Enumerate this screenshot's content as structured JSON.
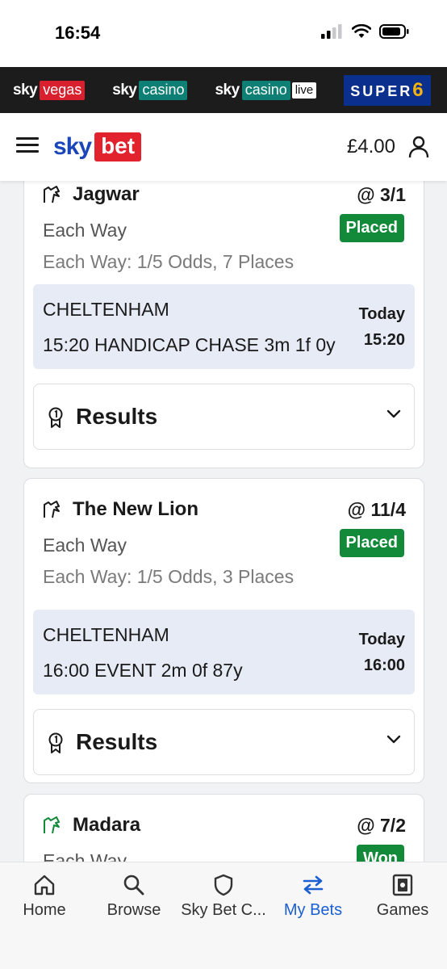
{
  "status_bar": {
    "time": "16:54"
  },
  "brands": [
    {
      "sky": "sky",
      "name": "vegas"
    },
    {
      "sky": "sky",
      "name": "casino"
    },
    {
      "sky": "sky",
      "name": "casino",
      "extra": "live"
    },
    {
      "name": "SUPER",
      "suffix": "6"
    }
  ],
  "header": {
    "logo_sky": "sky",
    "logo_bet": "bet",
    "balance": "£4.00"
  },
  "bets": [
    {
      "selection": "Jagwar",
      "odds": "@ 3/1",
      "bet_type": "Each Way",
      "status": "Placed",
      "terms": "Each Way: 1/5 Odds, 7 Places",
      "venue": "CHELTENHAM",
      "race": "15:20 HANDICAP CHASE 3m 1f 0y",
      "day": "Today",
      "time": "15:20",
      "results_label": "Results"
    },
    {
      "selection": "The New Lion",
      "odds": "@ 11/4",
      "bet_type": "Each Way",
      "status": "Placed",
      "terms": "Each Way: 1/5 Odds, 3 Places",
      "venue": "CHELTENHAM",
      "race": "16:00 EVENT 2m 0f 87y",
      "day": "Today",
      "time": "16:00",
      "results_label": "Results"
    },
    {
      "selection": "Madara",
      "odds": "@ 7/2",
      "bet_type": "Each Way",
      "status": "Won"
    }
  ],
  "colors": {
    "placed": "#128a3a",
    "won": "#128a3a",
    "accent": "#1b5fd1",
    "brand_red": "#e2232d"
  },
  "nav": [
    {
      "label": "Home",
      "icon": "home-icon"
    },
    {
      "label": "Browse",
      "icon": "search-icon"
    },
    {
      "label": "Sky Bet C...",
      "icon": "shield-icon"
    },
    {
      "label": "My Bets",
      "icon": "swap-arrows-icon",
      "active": true
    },
    {
      "label": "Games",
      "icon": "games-icon"
    }
  ]
}
